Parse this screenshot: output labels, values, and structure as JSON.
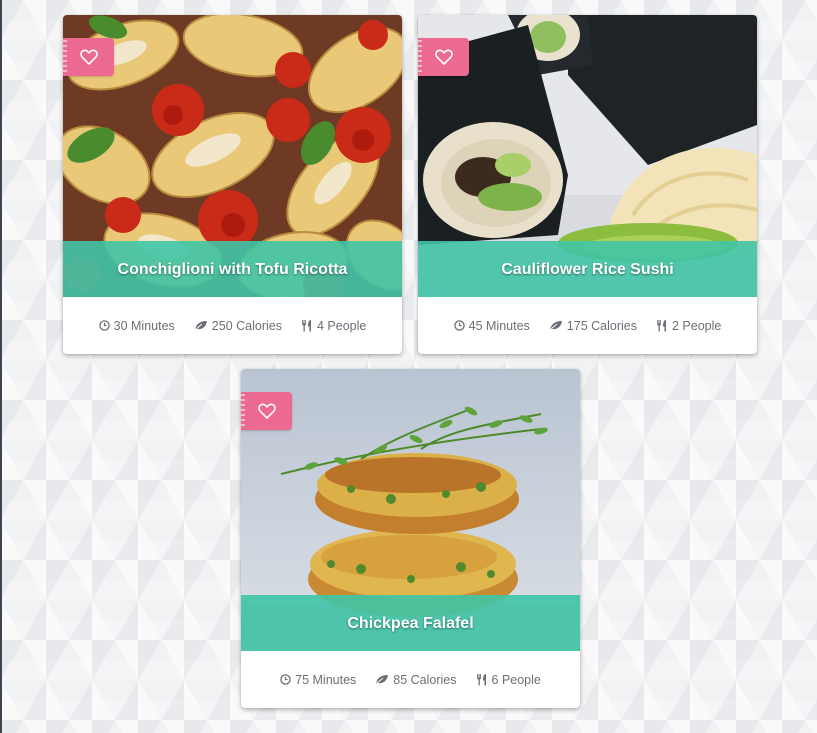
{
  "recipes": [
    {
      "title": "Conchiglioni with Tofu Ricotta",
      "time": "30 Minutes",
      "calories": "250 Calories",
      "people": "4 People"
    },
    {
      "title": "Cauliflower Rice Sushi",
      "time": "45 Minutes",
      "calories": "175 Calories",
      "people": "2 People"
    },
    {
      "title": "Chickpea Falafel",
      "time": "75 Minutes",
      "calories": "85 Calories",
      "people": "6 People"
    }
  ],
  "icons": {
    "favorite": "heart-icon",
    "time": "clock-icon",
    "calories": "leaf-icon",
    "people": "cutlery-icon"
  },
  "colors": {
    "accent_teal": "#40c4a6",
    "favorite_pink": "#ec6a91",
    "meta_text": "#6a6f76"
  }
}
